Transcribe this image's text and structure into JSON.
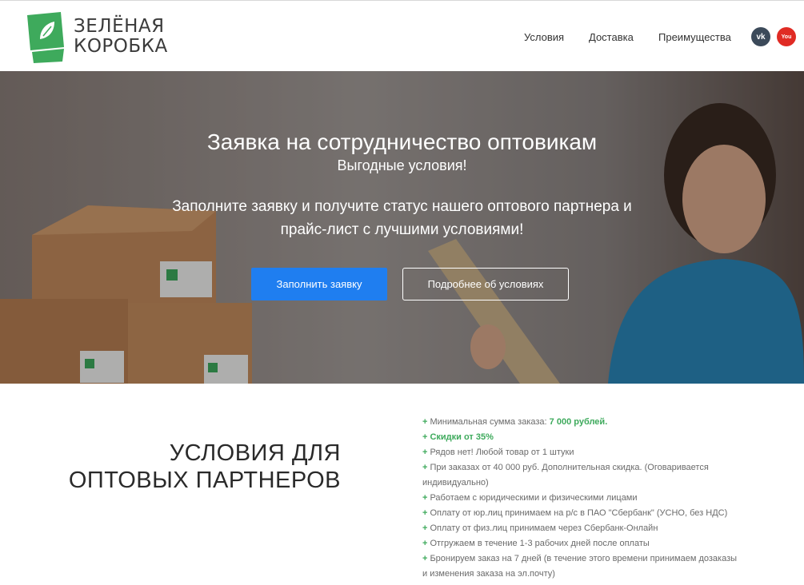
{
  "header": {
    "logo": {
      "line1": "ЗЕЛЁНАЯ",
      "line2": "КОРОБКА"
    },
    "nav": [
      {
        "label": "Условия"
      },
      {
        "label": "Доставка"
      },
      {
        "label": "Преимущества"
      }
    ],
    "social": {
      "vk": "vk",
      "youtube": "You"
    }
  },
  "hero": {
    "title": "Заявка на сотрудничество оптовикам",
    "subtitle": "Выгодные условия!",
    "text": "Заполните заявку и получите статус нашего оптового партнера и прайс-лист с лучшими условиями!",
    "primary_button": "Заполнить заявку",
    "secondary_button": "Подробнее об условиях",
    "box_logo_line1": "ЗЕЛЁНАЯ",
    "box_logo_line2": "КОРОБКА"
  },
  "terms": {
    "title": "УСЛОВИЯ ДЛЯ ОПТОВЫХ ПАРТНЕРОВ",
    "items": [
      {
        "prefix": "+",
        "text": "Минимальная сумма заказа: ",
        "highlight": "7 000 рублей."
      },
      {
        "prefix": "+",
        "text": "",
        "highlight": "Скидки от 35%"
      },
      {
        "prefix": "+",
        "text": "Рядов нет! Любой товар от 1 штуки",
        "highlight": ""
      },
      {
        "prefix": "+",
        "text": "При заказах от 40 000 руб. Дополнительная скидка. (Оговаривается индивидуально)",
        "highlight": ""
      },
      {
        "prefix": "+",
        "text": "Работаем с юридическими  и физическими лицами",
        "highlight": ""
      },
      {
        "prefix": "+",
        "text": "Оплату от юр.лиц принимаем на р/с в ПАО \"Сбербанк\" (УСНО, без НДС)",
        "highlight": ""
      },
      {
        "prefix": "+",
        "text": "Оплату от физ.лиц принимаем через Сбербанк-Онлайн",
        "highlight": ""
      },
      {
        "prefix": "+",
        "text": "Отгружаем в течение 1-3 рабочих дней после оплаты",
        "highlight": ""
      },
      {
        "prefix": "+",
        "text": "Бронируем заказ на 7 дней (в течение этого времени принимаем дозаказы и изменения заказа на эл.почту)",
        "highlight": ""
      }
    ]
  },
  "colors": {
    "brand_green": "#3eaa5c",
    "primary_blue": "#1f7ef0"
  }
}
